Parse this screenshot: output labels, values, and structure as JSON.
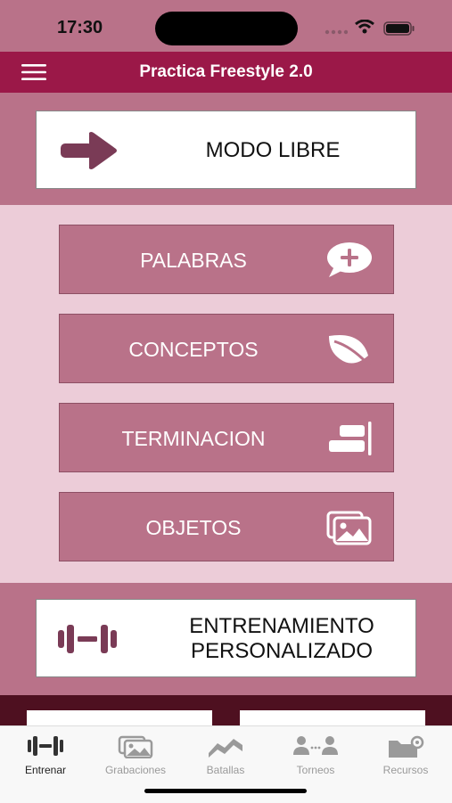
{
  "status_bar": {
    "time": "17:30"
  },
  "header": {
    "title": "Practica Freestyle 2.0"
  },
  "modo_libre": {
    "label": "MODO LIBRE",
    "icon": "arrow-right-icon"
  },
  "categories": [
    {
      "label": "PALABRAS",
      "icon": "chat-plus-icon"
    },
    {
      "label": "CONCEPTOS",
      "icon": "leaf-icon"
    },
    {
      "label": "TERMINACION",
      "icon": "align-right-icon"
    },
    {
      "label": "OBJETOS",
      "icon": "images-icon"
    }
  ],
  "entrenamiento": {
    "line1": "ENTRENAMIENTO",
    "line2": "PERSONALIZADO",
    "icon": "dumbbell-icon"
  },
  "tabs": [
    {
      "label": "Entrenar",
      "icon": "dumbbell-icon",
      "active": true
    },
    {
      "label": "Grabaciones",
      "icon": "images-icon",
      "active": false
    },
    {
      "label": "Batallas",
      "icon": "wave-icon",
      "active": false
    },
    {
      "label": "Torneos",
      "icon": "users-icon",
      "active": false
    },
    {
      "label": "Recursos",
      "icon": "folder-gear-icon",
      "active": false
    }
  ],
  "colors": {
    "header": "#9b1848",
    "band": "#b97289",
    "middle": "#ecccd8",
    "accent_dark": "#7a3b56"
  }
}
